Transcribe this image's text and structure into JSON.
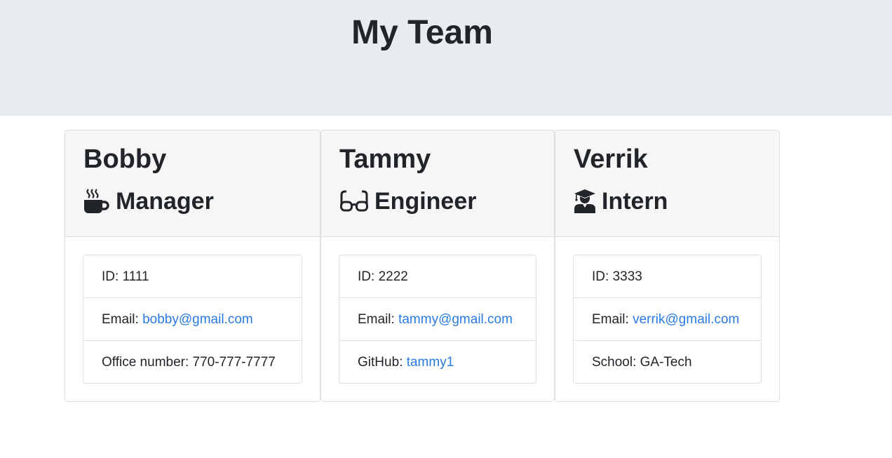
{
  "header": {
    "title": "My Team"
  },
  "cards": [
    {
      "name": "Bobby",
      "role": "Manager",
      "role_icon": "coffee-icon",
      "id_label": "ID: ",
      "id": "1111",
      "email_label": "Email: ",
      "email": "bobby@gmail.com",
      "extra_label": "Office number: ",
      "extra_value": "770-777-7777"
    },
    {
      "name": "Tammy",
      "role": "Engineer",
      "role_icon": "glasses-icon",
      "id_label": "ID: ",
      "id": "2222",
      "email_label": "Email: ",
      "email": "tammy@gmail.com",
      "extra_label": "GitHub: ",
      "extra_value": "tammy1"
    },
    {
      "name": "Verrik",
      "role": "Intern",
      "role_icon": "graduate-icon",
      "id_label": "ID: ",
      "id": "3333",
      "email_label": "Email: ",
      "email": "verrik@gmail.com",
      "extra_label": "School: ",
      "extra_value": "GA-Tech"
    }
  ],
  "colors": {
    "header_bg": "#e9ecef",
    "card_header_bg": "#f6f6f6",
    "link": "#2a7ae2",
    "text": "#212529"
  }
}
